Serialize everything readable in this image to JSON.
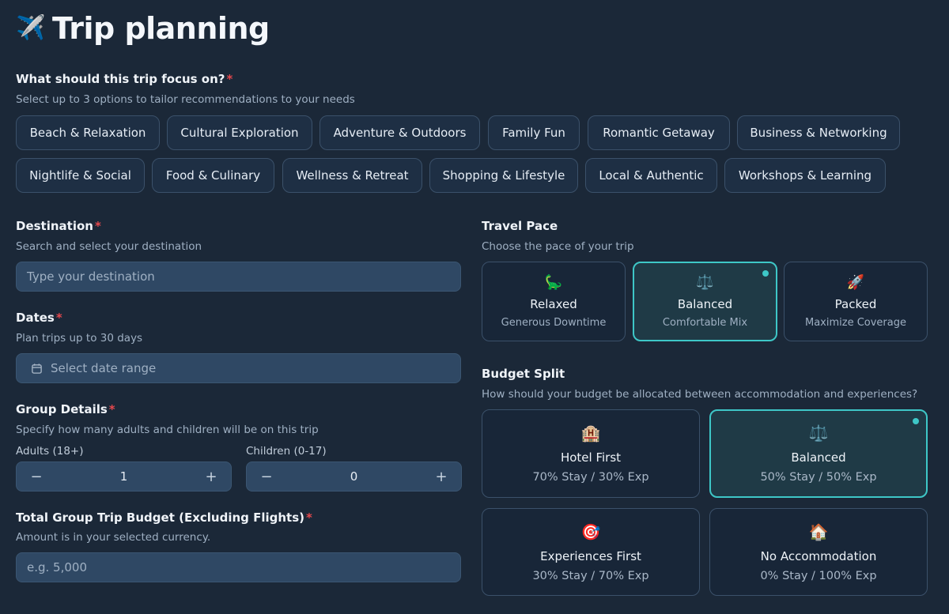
{
  "title_icon": "✈️",
  "title": "Trip planning",
  "focus": {
    "label": "What should this trip focus on?",
    "required_mark": "*",
    "hint": "Select up to 3 options to tailor recommendations to your needs",
    "options": [
      "Beach & Relaxation",
      "Cultural Exploration",
      "Adventure & Outdoors",
      "Family Fun",
      "Romantic Getaway",
      "Business & Networking",
      "Nightlife & Social",
      "Food & Culinary",
      "Wellness & Retreat",
      "Shopping & Lifestyle",
      "Local & Authentic",
      "Workshops & Learning"
    ]
  },
  "destination": {
    "label": "Destination",
    "required_mark": "*",
    "hint": "Search and select your destination",
    "placeholder": "Type your destination"
  },
  "dates": {
    "label": "Dates",
    "required_mark": "*",
    "hint": "Plan trips up to 30 days",
    "placeholder": "Select date range",
    "icon": "calendar-icon"
  },
  "group": {
    "label": "Group Details",
    "required_mark": "*",
    "hint": "Specify how many adults and children will be on this trip",
    "adults_label": "Adults (18+)",
    "adults_value": "1",
    "children_label": "Children (0-17)",
    "children_value": "0",
    "minus": "−",
    "plus": "+"
  },
  "budget": {
    "label": "Total Group Trip Budget (Excluding Flights)",
    "required_mark": "*",
    "hint": "Amount is in your selected currency.",
    "placeholder": "e.g. 5,000"
  },
  "pace": {
    "label": "Travel Pace",
    "hint": "Choose the pace of your trip",
    "options": [
      {
        "icon": "🦕",
        "icon_name": "dinosaur-icon",
        "name": "Relaxed",
        "sub": "Generous Downtime",
        "selected": false
      },
      {
        "icon": "⚖️",
        "icon_name": "scale-icon",
        "name": "Balanced",
        "sub": "Comfortable Mix",
        "selected": true
      },
      {
        "icon": "🚀",
        "icon_name": "rocket-icon",
        "name": "Packed",
        "sub": "Maximize Coverage",
        "selected": false
      }
    ]
  },
  "budget_split": {
    "label": "Budget Split",
    "hint": "How should your budget be allocated between accommodation and experiences?",
    "options": [
      {
        "icon": "🏨",
        "icon_name": "hotel-icon",
        "name": "Hotel First",
        "sub": "70% Stay / 30% Exp",
        "selected": false
      },
      {
        "icon": "⚖️",
        "icon_name": "scale-icon",
        "name": "Balanced",
        "sub": "50% Stay / 50% Exp",
        "selected": true
      },
      {
        "icon": "🎯",
        "icon_name": "target-icon",
        "name": "Experiences First",
        "sub": "30% Stay / 70% Exp",
        "selected": false
      },
      {
        "icon": "🏠",
        "icon_name": "house-icon",
        "name": "No Accommodation",
        "sub": "0% Stay / 100% Exp",
        "selected": false
      }
    ]
  },
  "colors": {
    "background": "#1b2838",
    "accent": "#3ec7c7",
    "required": "#e5484d"
  }
}
